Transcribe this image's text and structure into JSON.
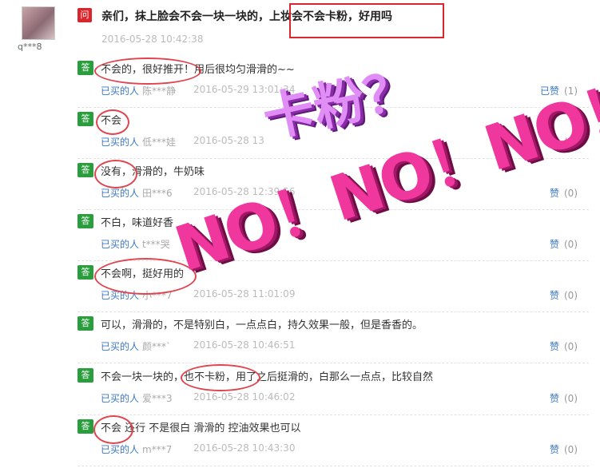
{
  "question": {
    "user": "q***8",
    "badge": "问",
    "text": "亲们，抹上脸会不会一块一块的，上妆会不会卡粉，好用吗",
    "date": "2016-05-28 10:42:38"
  },
  "answers": [
    {
      "badge": "答",
      "text": "不会的，很好推开！用后很均匀滑滑的~~",
      "buyer_label": "已买的人",
      "buyer": "陈***静",
      "date": "2016-05-29 13:01:34",
      "like_label": "已赞",
      "like_count": "(1)"
    },
    {
      "badge": "答",
      "text": "不会",
      "buyer_label": "已买的人",
      "buyer": "低***娃",
      "date": "2016-05-28 13",
      "like_label": "赞",
      "like_count": "(0)"
    },
    {
      "badge": "答",
      "text": "没有，滑滑的，牛奶味",
      "buyer_label": "已买的人",
      "buyer": "田***6",
      "date": "2016-05-28 12:39:56",
      "like_label": "赞",
      "like_count": "(0)"
    },
    {
      "badge": "答",
      "text": "不白，味道好香",
      "buyer_label": "已买的人",
      "buyer": "t***哭",
      "date": "10:18",
      "like_label": "赞",
      "like_count": "(0)"
    },
    {
      "badge": "答",
      "text": "不会啊，挺好用的",
      "buyer_label": "已买的人",
      "buyer": "小***7",
      "date": "2016-05-28 11:01:09",
      "like_label": "赞",
      "like_count": "(0)"
    },
    {
      "badge": "答",
      "text": "可以，滑滑的，不是特别白，一点点白，持久效果一般，但是香香的。",
      "buyer_label": "已买的人",
      "buyer": "颜***`",
      "date": "2016-05-28 10:46:51",
      "like_label": "赞",
      "like_count": "(0)"
    },
    {
      "badge": "答",
      "text": "不会一块一块的，也不卡粉，用了之后挺滑的，白那么一点点，比较自然",
      "buyer_label": "已买的人",
      "buyer": "爱***3",
      "date": "2016-05-28 10:46:02",
      "like_label": "赞",
      "like_count": "(0)"
    },
    {
      "badge": "答",
      "text": "不会 还行 不是很白 滑滑的 控油效果也可以",
      "buyer_label": "已买的人",
      "buyer": "m***7",
      "date": "2016-05-28 10:43:30",
      "like_label": "赞",
      "like_count": "(0)"
    }
  ],
  "overlay": {
    "title": "卡粉？",
    "no_text": "NO！NO！NO！"
  },
  "colors": {
    "question_badge": "#d8262c",
    "answer_badge": "#2a9e3c",
    "link": "#3a78c3",
    "annotation": "#e0454f",
    "overlay_purple": "#e08ef5",
    "overlay_pink": "#f0379e"
  }
}
